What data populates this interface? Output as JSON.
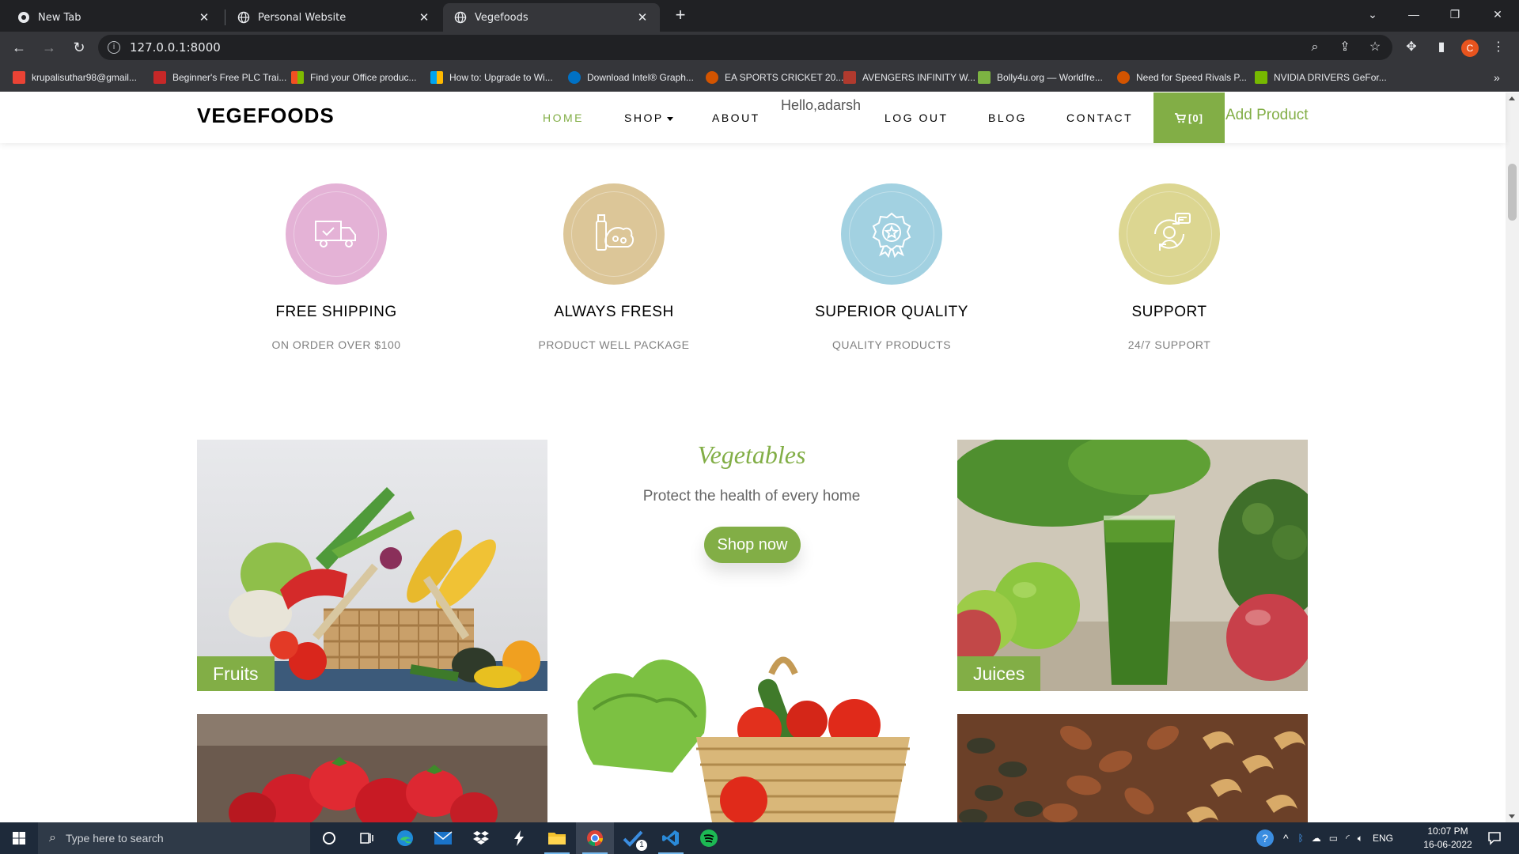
{
  "browser": {
    "tabs": [
      {
        "title": "New Tab"
      },
      {
        "title": "Personal Website"
      },
      {
        "title": "Vegefoods"
      }
    ],
    "url": "127.0.0.1:8000",
    "profile_initial": "C",
    "bookmarks": [
      {
        "label": "krupalisuthar98@gmail...",
        "color": "#ea4335"
      },
      {
        "label": "Beginner's Free PLC Trai...",
        "color": "#c62828"
      },
      {
        "label": "Find your Office produc...",
        "color": "#f25022"
      },
      {
        "label": "How to: Upgrade to Wi...",
        "color": "#00a4ef"
      },
      {
        "label": "Download Intel® Graph...",
        "color": "#0071c5"
      },
      {
        "label": "EA SPORTS CRICKET 20...",
        "color": "#d35400"
      },
      {
        "label": "AVENGERS INFINITY W...",
        "color": "#b03a2e"
      },
      {
        "label": "Bolly4u.org — Worldfre...",
        "color": "#7cb342"
      },
      {
        "label": "Need for Speed Rivals P...",
        "color": "#d35400"
      },
      {
        "label": "NVIDIA DRIVERS GeFor...",
        "color": "#76b900"
      }
    ],
    "bookmarks_overflow": "»"
  },
  "site": {
    "brand": "VEGEFOODS",
    "accent": "#82ae46",
    "nav": {
      "home": "HOME",
      "shop": "SHOP",
      "about": "ABOUT",
      "hello": "Hello,adarsh",
      "logout": "LOG OUT",
      "blog": "BLOG",
      "contact": "CONTACT",
      "cart": "[0]",
      "add_product": "Add Product"
    },
    "services": [
      {
        "title": "FREE SHIPPING",
        "subtitle": "ON ORDER OVER $100",
        "color": "#e4b2d6",
        "icon": "truck-icon"
      },
      {
        "title": "ALWAYS FRESH",
        "subtitle": "PRODUCT WELL PACKAGE",
        "color": "#dcc698",
        "icon": "produce-bag-icon"
      },
      {
        "title": "SUPERIOR QUALITY",
        "subtitle": "QUALITY PRODUCTS",
        "color": "#a2d1e1",
        "icon": "award-badge-icon"
      },
      {
        "title": "SUPPORT",
        "subtitle": "24/7 SUPPORT",
        "color": "#dcd691",
        "icon": "support-agent-icon"
      }
    ],
    "categories": {
      "fruits": "Fruits",
      "juices": "Juices"
    },
    "feature": {
      "title": "Vegetables",
      "subtitle": "Protect the health of every home",
      "button": "Shop now"
    }
  },
  "taskbar": {
    "search_placeholder": "Type here to search",
    "language": "ENG",
    "time": "10:07 PM",
    "date": "16-06-2022",
    "vscode_badge": "1"
  }
}
